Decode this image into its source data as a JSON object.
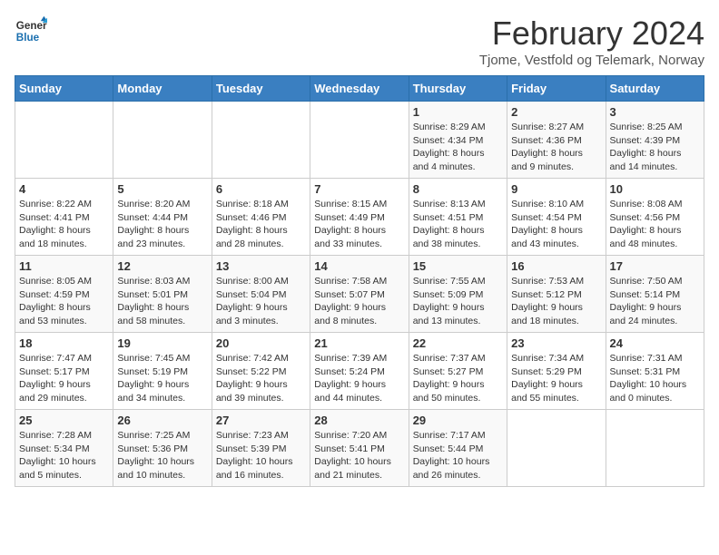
{
  "header": {
    "logo_line1": "General",
    "logo_line2": "Blue",
    "month_title": "February 2024",
    "subtitle": "Tjome, Vestfold og Telemark, Norway"
  },
  "days_of_week": [
    "Sunday",
    "Monday",
    "Tuesday",
    "Wednesday",
    "Thursday",
    "Friday",
    "Saturday"
  ],
  "weeks": [
    [
      {
        "day": "",
        "info": ""
      },
      {
        "day": "",
        "info": ""
      },
      {
        "day": "",
        "info": ""
      },
      {
        "day": "",
        "info": ""
      },
      {
        "day": "1",
        "info": "Sunrise: 8:29 AM\nSunset: 4:34 PM\nDaylight: 8 hours\nand 4 minutes."
      },
      {
        "day": "2",
        "info": "Sunrise: 8:27 AM\nSunset: 4:36 PM\nDaylight: 8 hours\nand 9 minutes."
      },
      {
        "day": "3",
        "info": "Sunrise: 8:25 AM\nSunset: 4:39 PM\nDaylight: 8 hours\nand 14 minutes."
      }
    ],
    [
      {
        "day": "4",
        "info": "Sunrise: 8:22 AM\nSunset: 4:41 PM\nDaylight: 8 hours\nand 18 minutes."
      },
      {
        "day": "5",
        "info": "Sunrise: 8:20 AM\nSunset: 4:44 PM\nDaylight: 8 hours\nand 23 minutes."
      },
      {
        "day": "6",
        "info": "Sunrise: 8:18 AM\nSunset: 4:46 PM\nDaylight: 8 hours\nand 28 minutes."
      },
      {
        "day": "7",
        "info": "Sunrise: 8:15 AM\nSunset: 4:49 PM\nDaylight: 8 hours\nand 33 minutes."
      },
      {
        "day": "8",
        "info": "Sunrise: 8:13 AM\nSunset: 4:51 PM\nDaylight: 8 hours\nand 38 minutes."
      },
      {
        "day": "9",
        "info": "Sunrise: 8:10 AM\nSunset: 4:54 PM\nDaylight: 8 hours\nand 43 minutes."
      },
      {
        "day": "10",
        "info": "Sunrise: 8:08 AM\nSunset: 4:56 PM\nDaylight: 8 hours\nand 48 minutes."
      }
    ],
    [
      {
        "day": "11",
        "info": "Sunrise: 8:05 AM\nSunset: 4:59 PM\nDaylight: 8 hours\nand 53 minutes."
      },
      {
        "day": "12",
        "info": "Sunrise: 8:03 AM\nSunset: 5:01 PM\nDaylight: 8 hours\nand 58 minutes."
      },
      {
        "day": "13",
        "info": "Sunrise: 8:00 AM\nSunset: 5:04 PM\nDaylight: 9 hours\nand 3 minutes."
      },
      {
        "day": "14",
        "info": "Sunrise: 7:58 AM\nSunset: 5:07 PM\nDaylight: 9 hours\nand 8 minutes."
      },
      {
        "day": "15",
        "info": "Sunrise: 7:55 AM\nSunset: 5:09 PM\nDaylight: 9 hours\nand 13 minutes."
      },
      {
        "day": "16",
        "info": "Sunrise: 7:53 AM\nSunset: 5:12 PM\nDaylight: 9 hours\nand 18 minutes."
      },
      {
        "day": "17",
        "info": "Sunrise: 7:50 AM\nSunset: 5:14 PM\nDaylight: 9 hours\nand 24 minutes."
      }
    ],
    [
      {
        "day": "18",
        "info": "Sunrise: 7:47 AM\nSunset: 5:17 PM\nDaylight: 9 hours\nand 29 minutes."
      },
      {
        "day": "19",
        "info": "Sunrise: 7:45 AM\nSunset: 5:19 PM\nDaylight: 9 hours\nand 34 minutes."
      },
      {
        "day": "20",
        "info": "Sunrise: 7:42 AM\nSunset: 5:22 PM\nDaylight: 9 hours\nand 39 minutes."
      },
      {
        "day": "21",
        "info": "Sunrise: 7:39 AM\nSunset: 5:24 PM\nDaylight: 9 hours\nand 44 minutes."
      },
      {
        "day": "22",
        "info": "Sunrise: 7:37 AM\nSunset: 5:27 PM\nDaylight: 9 hours\nand 50 minutes."
      },
      {
        "day": "23",
        "info": "Sunrise: 7:34 AM\nSunset: 5:29 PM\nDaylight: 9 hours\nand 55 minutes."
      },
      {
        "day": "24",
        "info": "Sunrise: 7:31 AM\nSunset: 5:31 PM\nDaylight: 10 hours\nand 0 minutes."
      }
    ],
    [
      {
        "day": "25",
        "info": "Sunrise: 7:28 AM\nSunset: 5:34 PM\nDaylight: 10 hours\nand 5 minutes."
      },
      {
        "day": "26",
        "info": "Sunrise: 7:25 AM\nSunset: 5:36 PM\nDaylight: 10 hours\nand 10 minutes."
      },
      {
        "day": "27",
        "info": "Sunrise: 7:23 AM\nSunset: 5:39 PM\nDaylight: 10 hours\nand 16 minutes."
      },
      {
        "day": "28",
        "info": "Sunrise: 7:20 AM\nSunset: 5:41 PM\nDaylight: 10 hours\nand 21 minutes."
      },
      {
        "day": "29",
        "info": "Sunrise: 7:17 AM\nSunset: 5:44 PM\nDaylight: 10 hours\nand 26 minutes."
      },
      {
        "day": "",
        "info": ""
      },
      {
        "day": "",
        "info": ""
      }
    ]
  ]
}
